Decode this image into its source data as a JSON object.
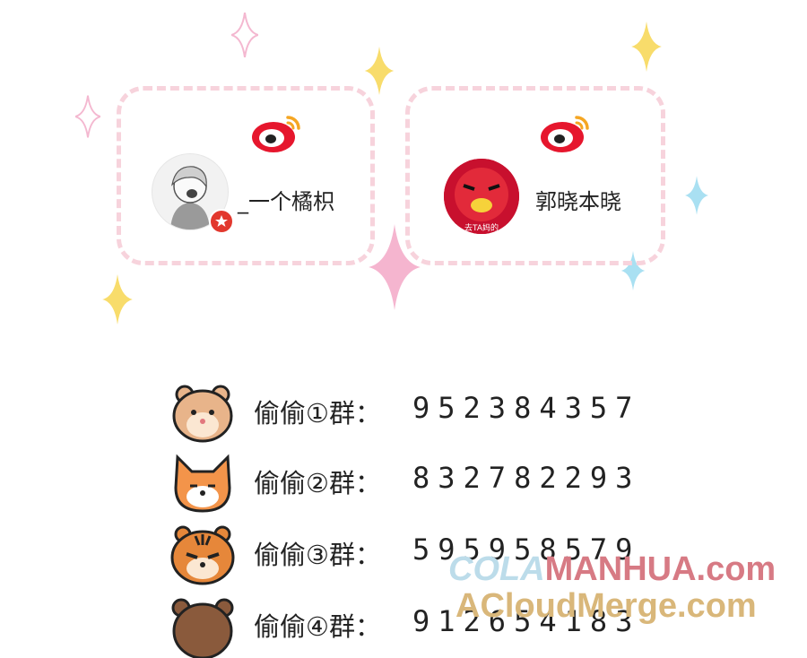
{
  "accounts": [
    {
      "name": "_一个橘枳",
      "platform_icon": "weibo-icon"
    },
    {
      "name": "郭晓本晓",
      "platform_icon": "weibo-icon",
      "avatar_caption": "去TA妈的"
    }
  ],
  "groups": [
    {
      "label": "偷偷①群：",
      "number": "952384357",
      "icon": "hamster-icon"
    },
    {
      "label": "偷偷②群：",
      "number": "832782293",
      "icon": "fox-icon"
    },
    {
      "label": "偷偷③群：",
      "number": "595958579",
      "icon": "tiger-icon"
    },
    {
      "label": "偷偷④群：",
      "number": "912654183",
      "icon": "bear-icon"
    }
  ],
  "watermark": {
    "line1_a": "COLA",
    "line1_b": "MANHUA.com",
    "line2": "ACloudMerge.com"
  },
  "colors": {
    "card_border": "#f7d3dc",
    "weibo_red": "#e6162d",
    "weibo_yellow": "#f5a623",
    "sparkle_yellow": "#f8dc6b",
    "sparkle_pink": "#f5b5cf",
    "sparkle_blue": "#a9e0f2"
  }
}
